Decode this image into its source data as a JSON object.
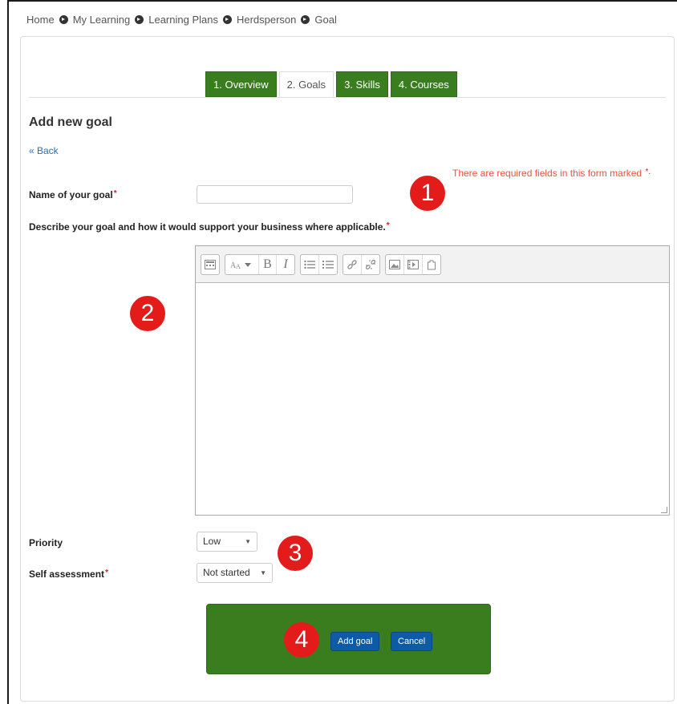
{
  "breadcrumb": [
    "Home",
    "My Learning",
    "Learning Plans",
    "Herdsperson",
    "Goal"
  ],
  "tabs": [
    {
      "label": "1. Overview",
      "active": false
    },
    {
      "label": "2. Goals",
      "active": true
    },
    {
      "label": "3. Skills",
      "active": false
    },
    {
      "label": "4. Courses",
      "active": false
    }
  ],
  "page": {
    "title": "Add new goal",
    "back_link": "« Back",
    "required_note": "There are required fields in this form marked",
    "required_star": "*."
  },
  "form": {
    "name_label": "Name of your goal",
    "name_value": "",
    "describe_label": "Describe your goal and how it would support your business where applicable.",
    "required_mark": "*",
    "toolbar_icons": [
      "show-more-buttons-icon",
      "paragraph-styles-icon",
      "bold-icon",
      "italic-icon",
      "unordered-list-icon",
      "ordered-list-icon",
      "link-icon",
      "unlink-icon",
      "insert-image-icon",
      "insert-media-icon",
      "manage-files-icon"
    ],
    "priority_label": "Priority",
    "priority_value": "Low",
    "self_assessment_label": "Self assessment",
    "self_assessment_value": "Not started",
    "add_button": "Add goal",
    "cancel_button": "Cancel"
  },
  "annotations": [
    "1",
    "2",
    "3",
    "4"
  ],
  "colors": {
    "tab_green": "#3a7d1f",
    "button_blue": "#0d5aa7",
    "marker_red": "#e41b1b",
    "required_red": "#e8533e",
    "link_blue": "#2a6fb5"
  }
}
